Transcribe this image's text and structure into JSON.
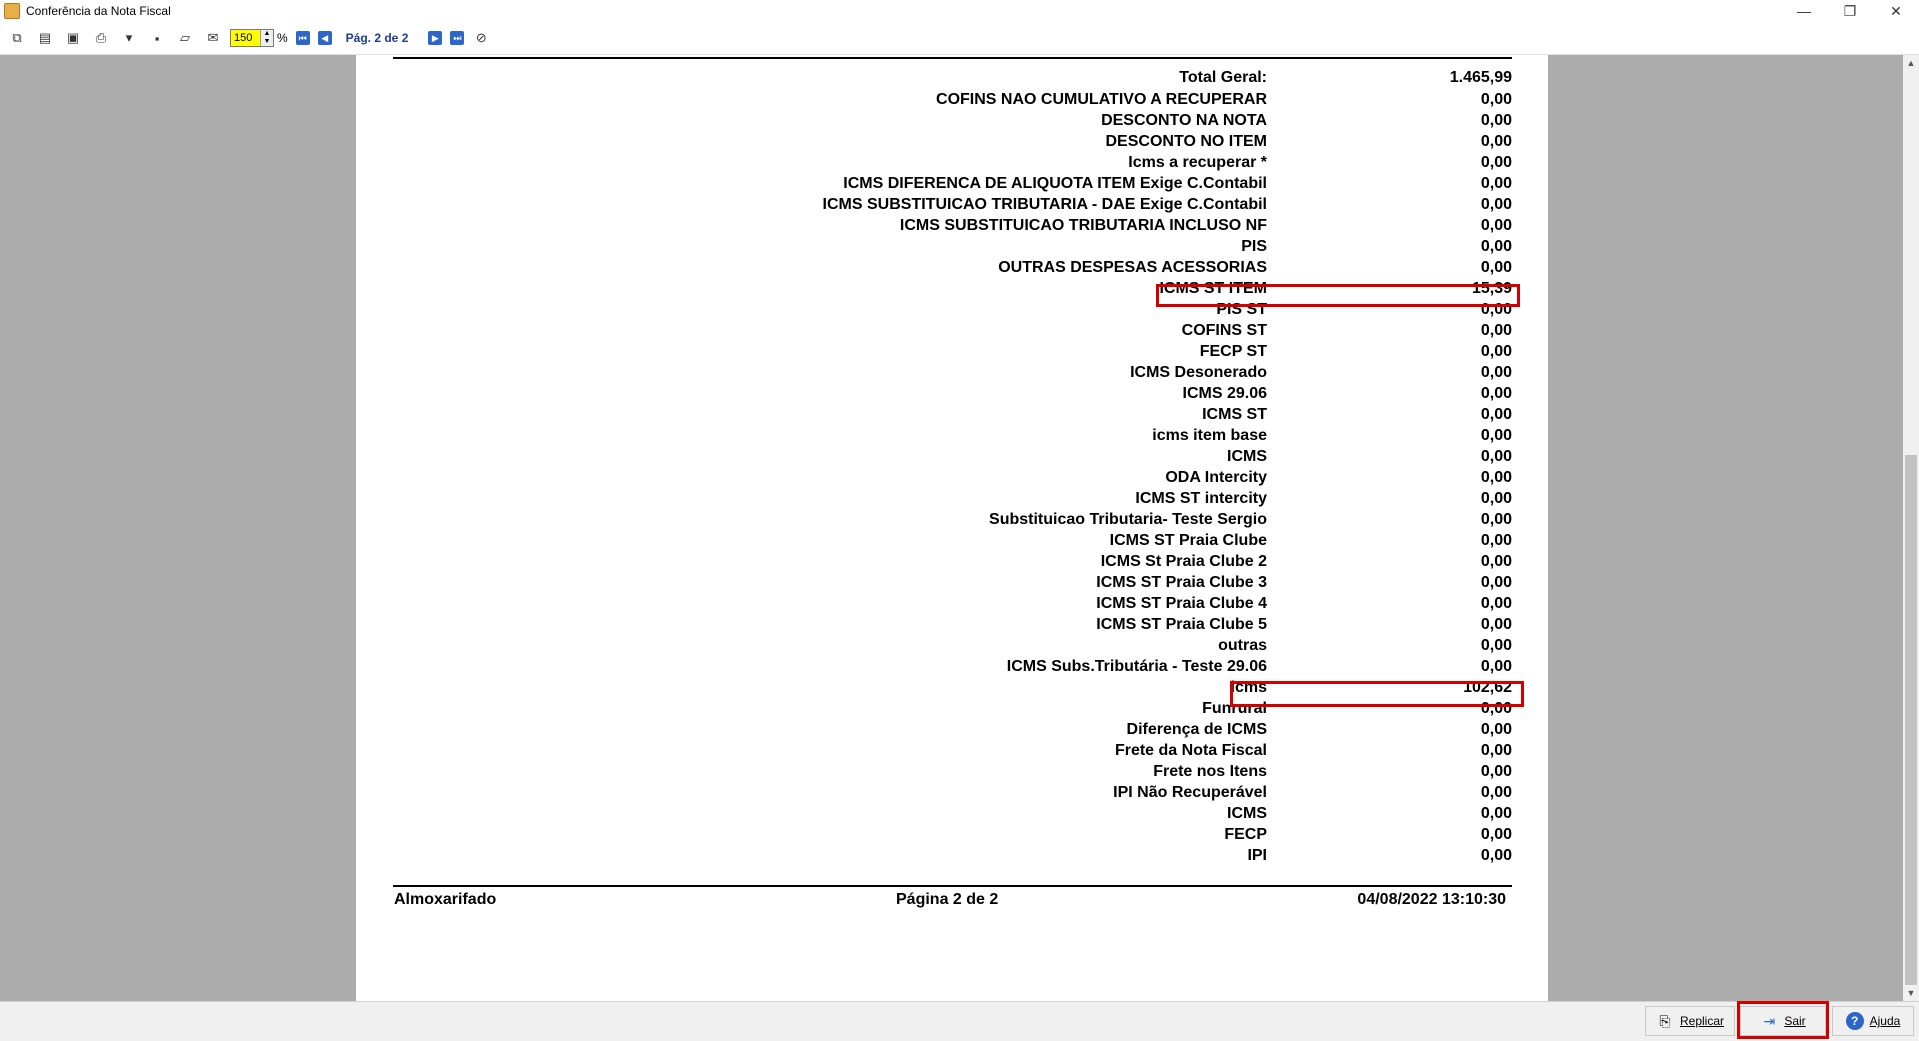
{
  "window": {
    "title": "Conferência da Nota Fiscal",
    "minimize_glyph": "—",
    "restore_glyph": "❐",
    "close_glyph": "✕"
  },
  "toolbar": {
    "zoom_value": "150",
    "zoom_unit": "%",
    "page_indicator": "Pág. 2 de 2"
  },
  "report": {
    "total_label": "Total Geral:",
    "total_value": "1.465,99",
    "items": [
      {
        "label": "COFINS NAO CUMULATIVO A RECUPERAR",
        "value": "0,00"
      },
      {
        "label": "DESCONTO NA NOTA",
        "value": "0,00"
      },
      {
        "label": "DESCONTO NO ITEM",
        "value": "0,00"
      },
      {
        "label": "Icms a recuperar *",
        "value": "0,00"
      },
      {
        "label": "ICMS DIFERENCA DE ALIQUOTA ITEM Exige C.Contabil",
        "value": "0,00"
      },
      {
        "label": "ICMS SUBSTITUICAO TRIBUTARIA - DAE Exige C.Contabil",
        "value": "0,00"
      },
      {
        "label": "ICMS SUBSTITUICAO TRIBUTARIA INCLUSO NF",
        "value": "0,00"
      },
      {
        "label": "PIS",
        "value": "0,00"
      },
      {
        "label": "OUTRAS DESPESAS ACESSORIAS",
        "value": "0,00"
      },
      {
        "label": "ICMS ST ITEM",
        "value": "15,39"
      },
      {
        "label": "PIS ST",
        "value": "0,00"
      },
      {
        "label": "COFINS ST",
        "value": "0,00"
      },
      {
        "label": "FECP ST",
        "value": "0,00"
      },
      {
        "label": "ICMS Desonerado",
        "value": "0,00"
      },
      {
        "label": "ICMS 29.06",
        "value": "0,00"
      },
      {
        "label": "ICMS ST",
        "value": "0,00"
      },
      {
        "label": "icms item base",
        "value": "0,00"
      },
      {
        "label": "ICMS",
        "value": "0,00"
      },
      {
        "label": "ODA Intercity",
        "value": "0,00"
      },
      {
        "label": "ICMS ST intercity",
        "value": "0,00"
      },
      {
        "label": "Substituicao Tributaria- Teste Sergio",
        "value": "0,00"
      },
      {
        "label": "ICMS ST Praia Clube",
        "value": "0,00"
      },
      {
        "label": "ICMS St Praia Clube 2",
        "value": "0,00"
      },
      {
        "label": "ICMS ST Praia Clube 3",
        "value": "0,00"
      },
      {
        "label": "ICMS ST Praia Clube 4",
        "value": "0,00"
      },
      {
        "label": "ICMS ST Praia Clube 5",
        "value": "0,00"
      },
      {
        "label": "outras",
        "value": "0,00"
      },
      {
        "label": "ICMS Subs.Tributária - Teste 29.06",
        "value": "0,00"
      },
      {
        "label": "icms",
        "value": "102,62"
      },
      {
        "label": "Funrural",
        "value": "0,00"
      },
      {
        "label": "Diferença de ICMS",
        "value": "0,00"
      },
      {
        "label": "Frete da Nota Fiscal",
        "value": "0,00"
      },
      {
        "label": "Frete nos Itens",
        "value": "0,00"
      },
      {
        "label": "IPI Não Recuperável",
        "value": "0,00"
      },
      {
        "label": "ICMS",
        "value": "0,00"
      },
      {
        "label": "FECP",
        "value": "0,00"
      },
      {
        "label": "IPI",
        "value": "0,00"
      }
    ],
    "footer": {
      "left": "Almoxarifado",
      "center": "Página 2 de 2",
      "right": "04/08/2022 13:10:30"
    }
  },
  "bottom_buttons": {
    "replicar": "Replicar",
    "sair": "Sair",
    "ajuda": "Ajuda"
  },
  "highlight_color": "#d40000"
}
